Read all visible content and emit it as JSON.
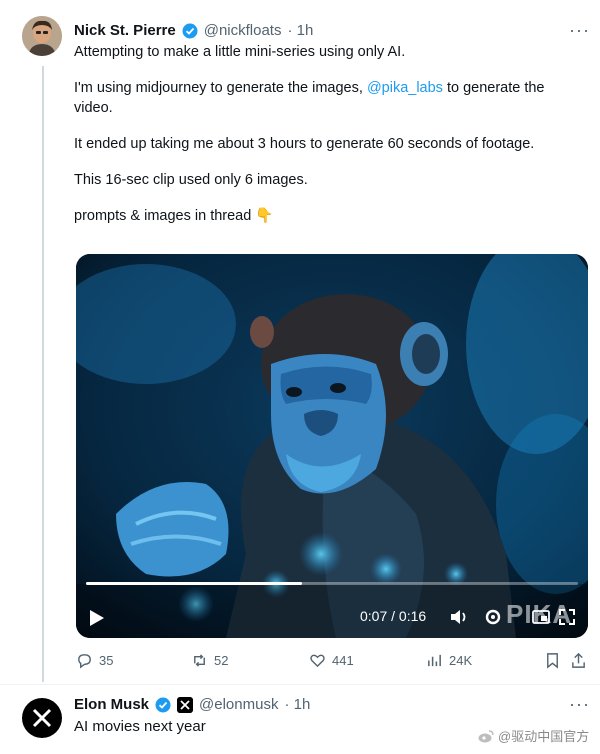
{
  "tweet": {
    "author_name": "Nick St. Pierre",
    "handle": "@nickfloats",
    "time": "· 1h",
    "more": "···",
    "paragraphs": {
      "p1": "Attempting to make a little mini-series using only AI.",
      "p2_before": "I'm using midjourney to generate the images, ",
      "p2_mention": "@pika_labs",
      "p2_after": " to generate the video.",
      "p3": "It ended up taking me about 3 hours to generate 60 seconds of footage.",
      "p4": "This 16-sec clip used only 6 images.",
      "p5": "prompts & images in thread",
      "p5_emoji": "👇"
    },
    "video": {
      "current_time": "0:07",
      "separator": " / ",
      "duration": "0:16",
      "progress_fraction": 0.44,
      "watermark": "PIKA"
    },
    "stats": {
      "replies": "35",
      "reposts": "52",
      "likes": "441",
      "views": "24K"
    }
  },
  "reply": {
    "author_name": "Elon Musk",
    "handle": "@elonmusk",
    "time": "· 1h",
    "more": "···",
    "text": "AI movies next year"
  },
  "watermark_text": "@驱动中国官方",
  "colors": {
    "accent": "#1d9bf0",
    "muted": "#536471",
    "text": "#0f1419"
  }
}
